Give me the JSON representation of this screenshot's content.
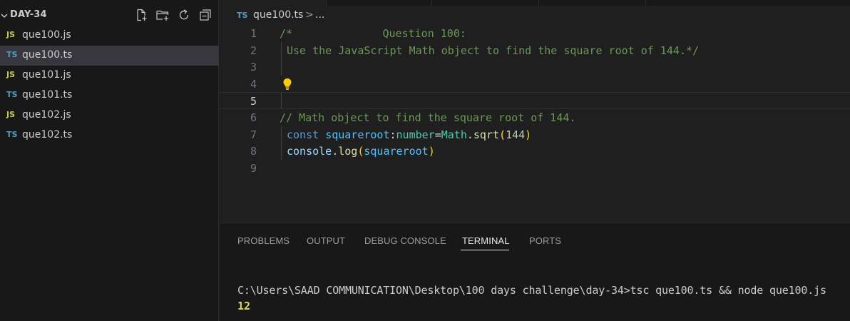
{
  "explorer": {
    "folder_name": "DAY-34",
    "files": [
      {
        "badge": "JS",
        "lang": "js",
        "name": "que100.js",
        "selected": false
      },
      {
        "badge": "TS",
        "lang": "ts",
        "name": "que100.ts",
        "selected": true
      },
      {
        "badge": "JS",
        "lang": "js",
        "name": "que101.js",
        "selected": false
      },
      {
        "badge": "TS",
        "lang": "ts",
        "name": "que101.ts",
        "selected": false
      },
      {
        "badge": "JS",
        "lang": "js",
        "name": "que102.js",
        "selected": false
      },
      {
        "badge": "TS",
        "lang": "ts",
        "name": "que102.ts",
        "selected": false
      }
    ],
    "actions": [
      "new-file-icon",
      "new-folder-icon",
      "refresh-icon",
      "collapse-all-icon"
    ]
  },
  "breadcrumb": {
    "badge": "TS",
    "file": "que100.ts",
    "separator": ">",
    "more": "..."
  },
  "editor": {
    "line_numbers": [
      "1",
      "2",
      "3",
      "4",
      "5",
      "6",
      "7",
      "8",
      "9"
    ],
    "current_line": "5",
    "code": {
      "l1_comment": "/*              Question 100:",
      "l2_comment": "Use the JavaScript Math object to find the square root of 144.*/",
      "l6_comment": "// Math object to find the square root of 144.",
      "l7_const": "const",
      "l7_var": "squareroot",
      "l7_colon": ":",
      "l7_type": "number",
      "l7_eq": "=",
      "l7_math": "Math",
      "l7_dot": ".",
      "l7_fn": "sqrt",
      "l7_open": "(",
      "l7_num": "144",
      "l7_close": ")",
      "l8_console": "console",
      "l8_dot": ".",
      "l8_fn": "log",
      "l8_open": "(",
      "l8_arg": "squareroot",
      "l8_close": ")"
    }
  },
  "panel": {
    "tabs": {
      "problems": "PROBLEMS",
      "output": "OUTPUT",
      "debug_console": "DEBUG CONSOLE",
      "terminal": "TERMINAL",
      "ports": "PORTS"
    },
    "active_tab": "TERMINAL",
    "terminal": {
      "command_line": "C:\\Users\\SAAD COMMUNICATION\\Desktop\\100 days challenge\\day-34>tsc que100.ts && node que100.js",
      "output": "12"
    }
  },
  "colors": {
    "js_badge": "#cbcb41",
    "ts_badge": "#519aba",
    "comment": "#6a9955",
    "keyword": "#569cd6",
    "terminal_output": "#dcdc50"
  }
}
